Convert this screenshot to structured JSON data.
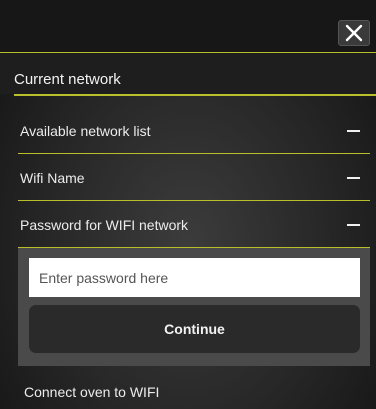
{
  "dialog": {
    "close_icon": "close-icon",
    "title": "Current network"
  },
  "rows": [
    {
      "label": "Available network list",
      "icon": "minus-icon"
    },
    {
      "label": "Wifi Name",
      "icon": "minus-icon"
    },
    {
      "label": "Password for WIFI network",
      "icon": "minus-icon"
    }
  ],
  "password_panel": {
    "placeholder": "Enter password here",
    "value": "",
    "continue_label": "Continue"
  },
  "footer": {
    "label": "Connect oven to WIFI"
  },
  "colors": {
    "accent": "#b8bf2a",
    "panel": "#4a4a4a",
    "button": "#2a2a2a"
  }
}
